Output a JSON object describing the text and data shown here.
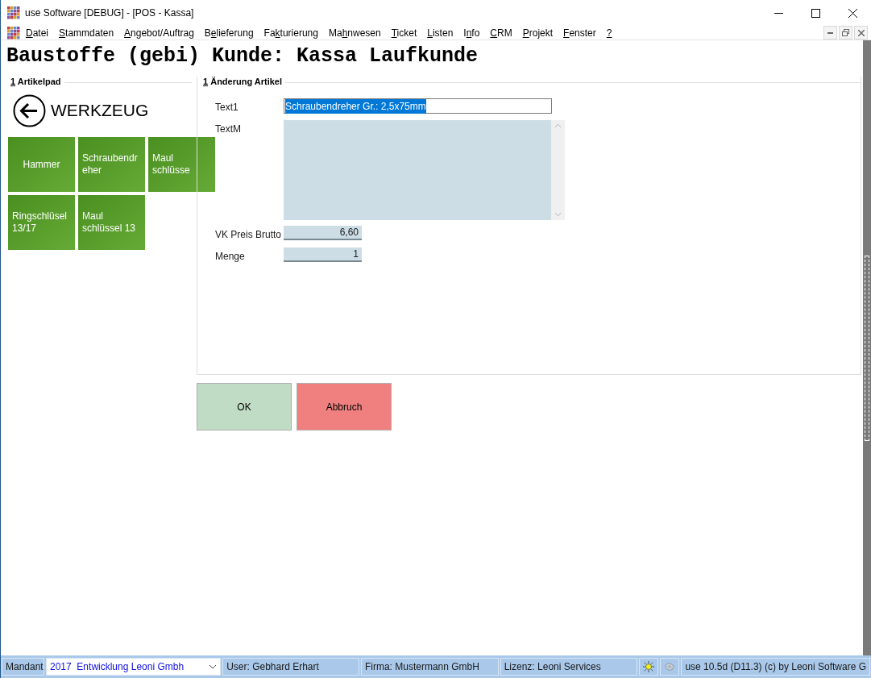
{
  "window": {
    "title": "use Software [DEBUG] - [POS - Kassa]"
  },
  "menu": [
    {
      "key": "D",
      "post": "atei"
    },
    {
      "key": "S",
      "post": "tammdaten"
    },
    {
      "key": "A",
      "post": "ngebot/Auftrag"
    },
    {
      "pre": "B",
      "key": "e",
      "post": "lieferung"
    },
    {
      "pre": "Fa",
      "key": "k",
      "post": "turierung"
    },
    {
      "pre": "Ma",
      "key": "h",
      "post": "nwesen"
    },
    {
      "key": "T",
      "post": "icket"
    },
    {
      "key": "L",
      "post": "isten"
    },
    {
      "pre": "I",
      "key": "n",
      "post": "fo"
    },
    {
      "key": "C",
      "post": "RM"
    },
    {
      "key": "P",
      "post": "rojekt"
    },
    {
      "key": "F",
      "post": "enster"
    },
    {
      "key": "?"
    }
  ],
  "heading": "Baustoffe (gebi) Kunde: Kassa Laufkunde",
  "artikelpad": {
    "key": "1",
    "title": " Artikelpad",
    "category": "WERKZEUG",
    "tiles": [
      {
        "label": "Hammer",
        "kind": "centered"
      },
      {
        "label": "Schraubendr eher",
        "kind": "wrapped"
      },
      {
        "label": "Maul schlüsse",
        "kind": "wrapped"
      },
      {
        "label": "Ringschlüsel 13/17",
        "kind": "wrapped"
      },
      {
        "label": "Maul schlüssel 13",
        "kind": "wrapped"
      }
    ]
  },
  "form": {
    "key": "1",
    "title": " Änderung Artikel",
    "fields": [
      {
        "label": "Text1",
        "kind": "text",
        "value": "Schraubendreher Gr.: 2,5x75mm",
        "selected": true
      },
      {
        "label": "TextM",
        "kind": "textarea"
      },
      {
        "label": "VK Preis Brutto",
        "kind": "number",
        "value": "6,60"
      },
      {
        "label": "Menge",
        "kind": "number",
        "value": "1"
      }
    ]
  },
  "buttons": [
    {
      "label": "OK",
      "kind": "ok"
    },
    {
      "label": "Abbruch",
      "kind": "cancel"
    }
  ],
  "status_bar": {
    "mandant_label": "Mandant",
    "mandant_value": "2017  Entwicklung Leoni Gmbh",
    "user": "User: Gebhard Erhart",
    "firma": "Firma: Mustermann GmbH",
    "lizenz": "Lizenz: Leoni Services",
    "version": "use 10.5d (D11.3) (c) by Leoni Software G"
  }
}
